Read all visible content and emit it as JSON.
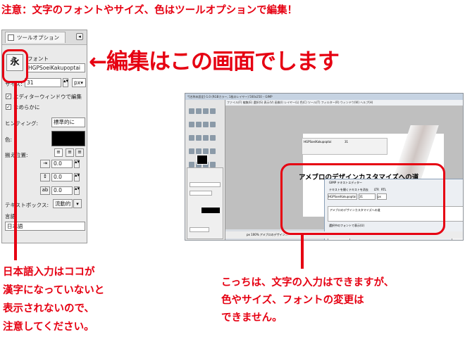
{
  "header": {
    "note": "注意：文字のフォントやサイズ、色はツールオプションで編集！",
    "edit_here": "←編集はこの画面でします"
  },
  "tool_options": {
    "tab_label": "ツールオプション",
    "tool_glyph": "永",
    "font_label": "フォント",
    "font_value": "HGPSoeiKakupoptai",
    "size_label": "サイズ:",
    "size_value": "31",
    "size_unit": "px",
    "use_editor_label": "エディターウィンドウで編集",
    "antialias_label": "なめらかに",
    "hinting_label": "ヒンティング:",
    "hinting_value": "標準的に",
    "color_label": "色:",
    "color_value": "#000000",
    "justify_label": "揃え位置:",
    "indent_value": "0.0",
    "line_spacing_value": "0.0",
    "letter_spacing_value": "0.0",
    "textbox_label": "テキストボックス:",
    "textbox_value": "流動的",
    "language_label": "言語",
    "language_value": "日本語"
  },
  "annotations": {
    "left_note": [
      "日本語入力はココが",
      "漢字になっていないと",
      "表示されないので、",
      "注意してください。"
    ],
    "right_note": [
      "こっちは、文字の入力はできますが、",
      "色やサイズ、フォントの変更は",
      "できません。"
    ],
    "accent_color": "#e60012"
  },
  "gimp_window": {
    "title": "*[名称未設定]-1.0 (RGBカラー, 1枚のレイヤー) 500x250 – GIMP",
    "menu": "ファイル(F)  編集(E)  選択(S)  表示(V)  画像(I)  レイヤー(L)  色(C)  ツール(T)  フィルター(R)  ウィンドウ(W)  ヘルプ(H)",
    "canvas_text": "アメブロのデザインカスタマイズへの道",
    "font_small": "HGPSoeiKakupoptai",
    "size_small": "31",
    "dialog_title": "GIMP テキストエディター",
    "dialog_open": "テキストを開く",
    "dialog_clear": "テキストを消去",
    "dialog_ltr": "LTR",
    "dialog_rtl": "RTL",
    "dialog_font": "HGPSoeiKakupoptai",
    "dialog_size": "31",
    "dialog_unit": "px",
    "dialog_text": "アメブロのデザインカスタマイズへの道",
    "dialog_check_label": "選択中のフォントで表示(U)",
    "help_button": "ヘルプ(H)",
    "close_button": "閉じる(C)",
    "status": "px  100%  アメブロのデザイン…"
  }
}
